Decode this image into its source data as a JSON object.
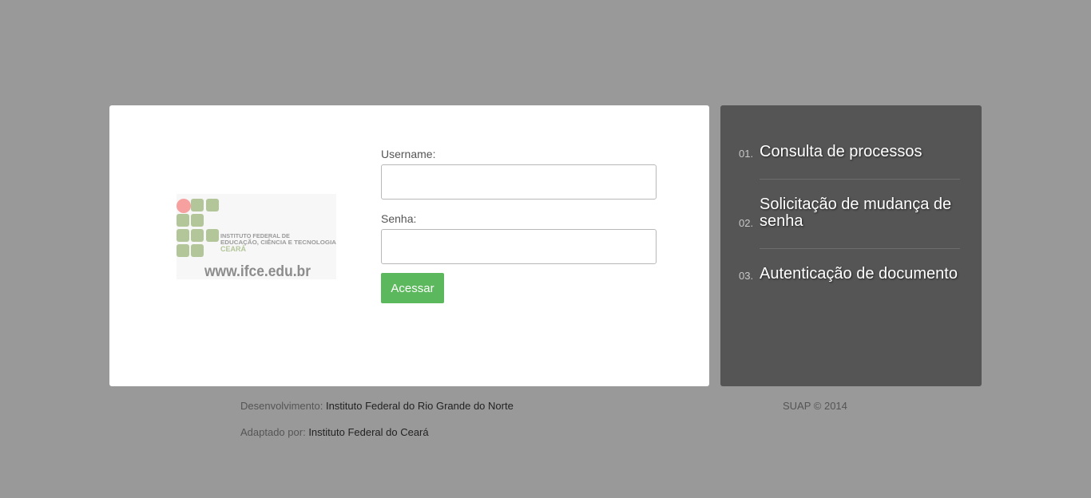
{
  "logo": {
    "line1": "INSTITUTO FEDERAL DE",
    "line2": "EDUCAÇÃO, CIÊNCIA E TECNOLOGIA",
    "campus": "CEARÁ",
    "url": "www.ifce.edu.br"
  },
  "form": {
    "username_label": "Username:",
    "username_value": "",
    "password_label": "Senha:",
    "password_value": "",
    "submit_label": "Acessar"
  },
  "sidebar": {
    "items": [
      {
        "number": "01.",
        "label": "Consulta de processos"
      },
      {
        "number": "02.",
        "label": "Solicitação de mudança de senha"
      },
      {
        "number": "03.",
        "label": "Autenticação de documento"
      }
    ]
  },
  "footer": {
    "dev_prefix": "Desenvolvimento:",
    "dev_link": "Instituto Federal do Rio Grande do Norte",
    "adapt_prefix": "Adaptado por:",
    "adapt_link": "Instituto Federal do Ceará",
    "copyright": "SUAP © 2014"
  },
  "colors": {
    "background": "#999999",
    "panel": "#555555",
    "button": "#5cb85c",
    "logo_green": "#b3c69a",
    "logo_red": "#f6a0a0"
  }
}
